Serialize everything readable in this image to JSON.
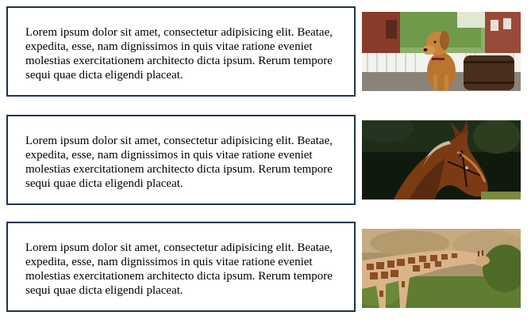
{
  "cards": [
    {
      "text": "Lorem ipsum dolor sit amet, consectetur adipisicing elit. Beatae, expedita, esse, nam dignissimos in quis vitae ratione eveniet molestias exercitationem architecto dicta ipsum. Rerum tempore sequi quae dicta eligendi placeat.",
      "image": "dog-photo"
    },
    {
      "text": "Lorem ipsum dolor sit amet, consectetur adipisicing elit. Beatae, expedita, esse, nam dignissimos in quis vitae ratione eveniet molestias exercitationem architecto dicta ipsum. Rerum tempore sequi quae dicta eligendi placeat.",
      "image": "horse-photo"
    },
    {
      "text": "Lorem ipsum dolor sit amet, consectetur adipisicing elit. Beatae, expedita, esse, nam dignissimos in quis vitae ratione eveniet molestias exercitationem architecto dicta ipsum. Rerum tempore sequi quae dicta eligendi placeat.",
      "image": "giraffe-photo"
    }
  ],
  "colors": {
    "border": "#1f3350",
    "text": "#000000",
    "background": "#ffffff"
  }
}
